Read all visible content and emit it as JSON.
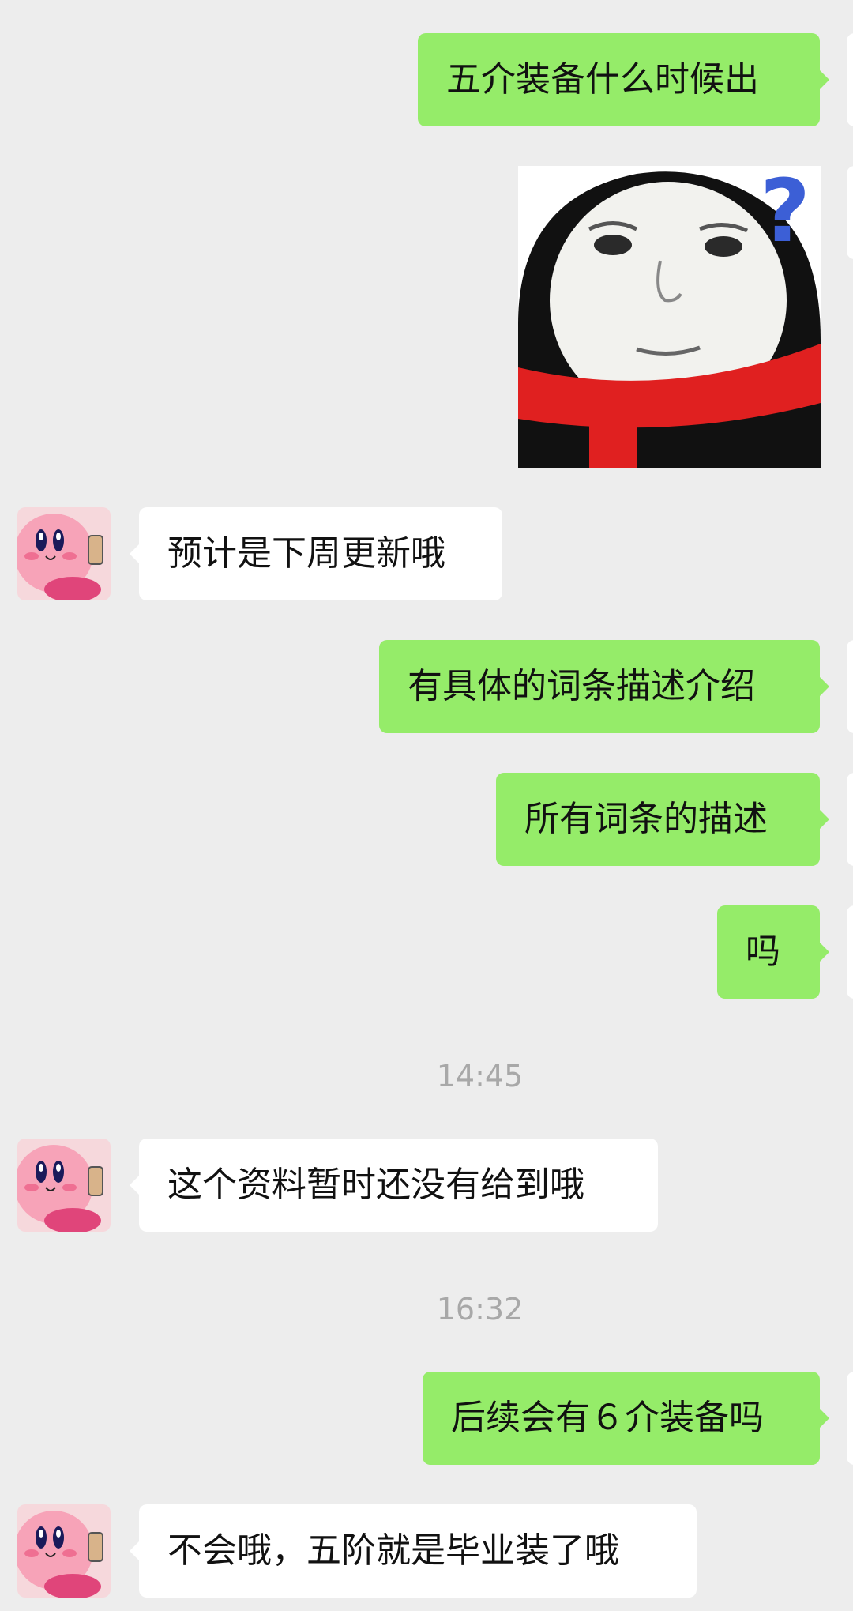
{
  "messages": [
    {
      "text": "五介装备什么时候出",
      "direction": "outgoing"
    },
    {
      "sticker": "penguin-meme-question-sticker",
      "direction": "outgoing"
    },
    {
      "text": "预计是下周更新哦",
      "direction": "incoming"
    },
    {
      "text": "有具体的词条描述介绍",
      "direction": "outgoing"
    },
    {
      "text": "所有词条的描述",
      "direction": "outgoing"
    },
    {
      "text": "吗",
      "direction": "outgoing"
    },
    {
      "text": "这个资料暂时还没有给到哦",
      "direction": "incoming"
    },
    {
      "text": "后续会有６介装备吗",
      "direction": "outgoing"
    },
    {
      "text": "不会哦，五阶就是毕业装了哦",
      "direction": "incoming"
    }
  ],
  "timestamps": [
    "14:45",
    "16:32"
  ],
  "colors": {
    "background": "#ededed",
    "outgoing_bubble": "#95ec69",
    "incoming_bubble": "#ffffff",
    "timestamp_text": "#a8a8a8"
  },
  "icons": {
    "contact_avatar": "kirby-avatar"
  }
}
